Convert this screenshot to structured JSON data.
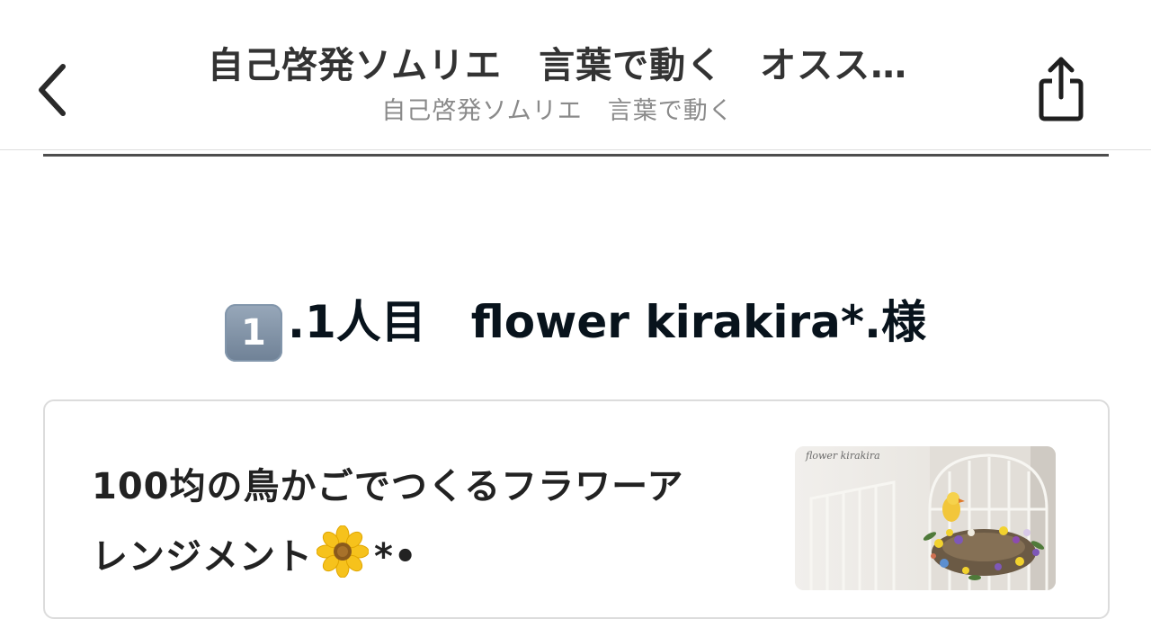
{
  "header": {
    "title": "自己啓発ソムリエ　言葉で動く　オスス…",
    "subtitle": "自己啓発ソムリエ　言葉で動く",
    "back_icon": "chevron-left-icon",
    "share_icon": "share-icon"
  },
  "section": {
    "badge": "1",
    "heading": ".1人目　flower kirakira*.様"
  },
  "card": {
    "title_line1": "100均の鳥かごでつくるフラワーア",
    "title_line2": "レンジメント",
    "title_suffix": "*•",
    "thumbnail_caption": "flower kirakira",
    "flower_icon": "flower-icon"
  },
  "colors": {
    "title_text": "#333333",
    "subtitle_text": "#8a8a8a",
    "heading_text": "#08131c",
    "card_border": "#dcdcdc"
  }
}
